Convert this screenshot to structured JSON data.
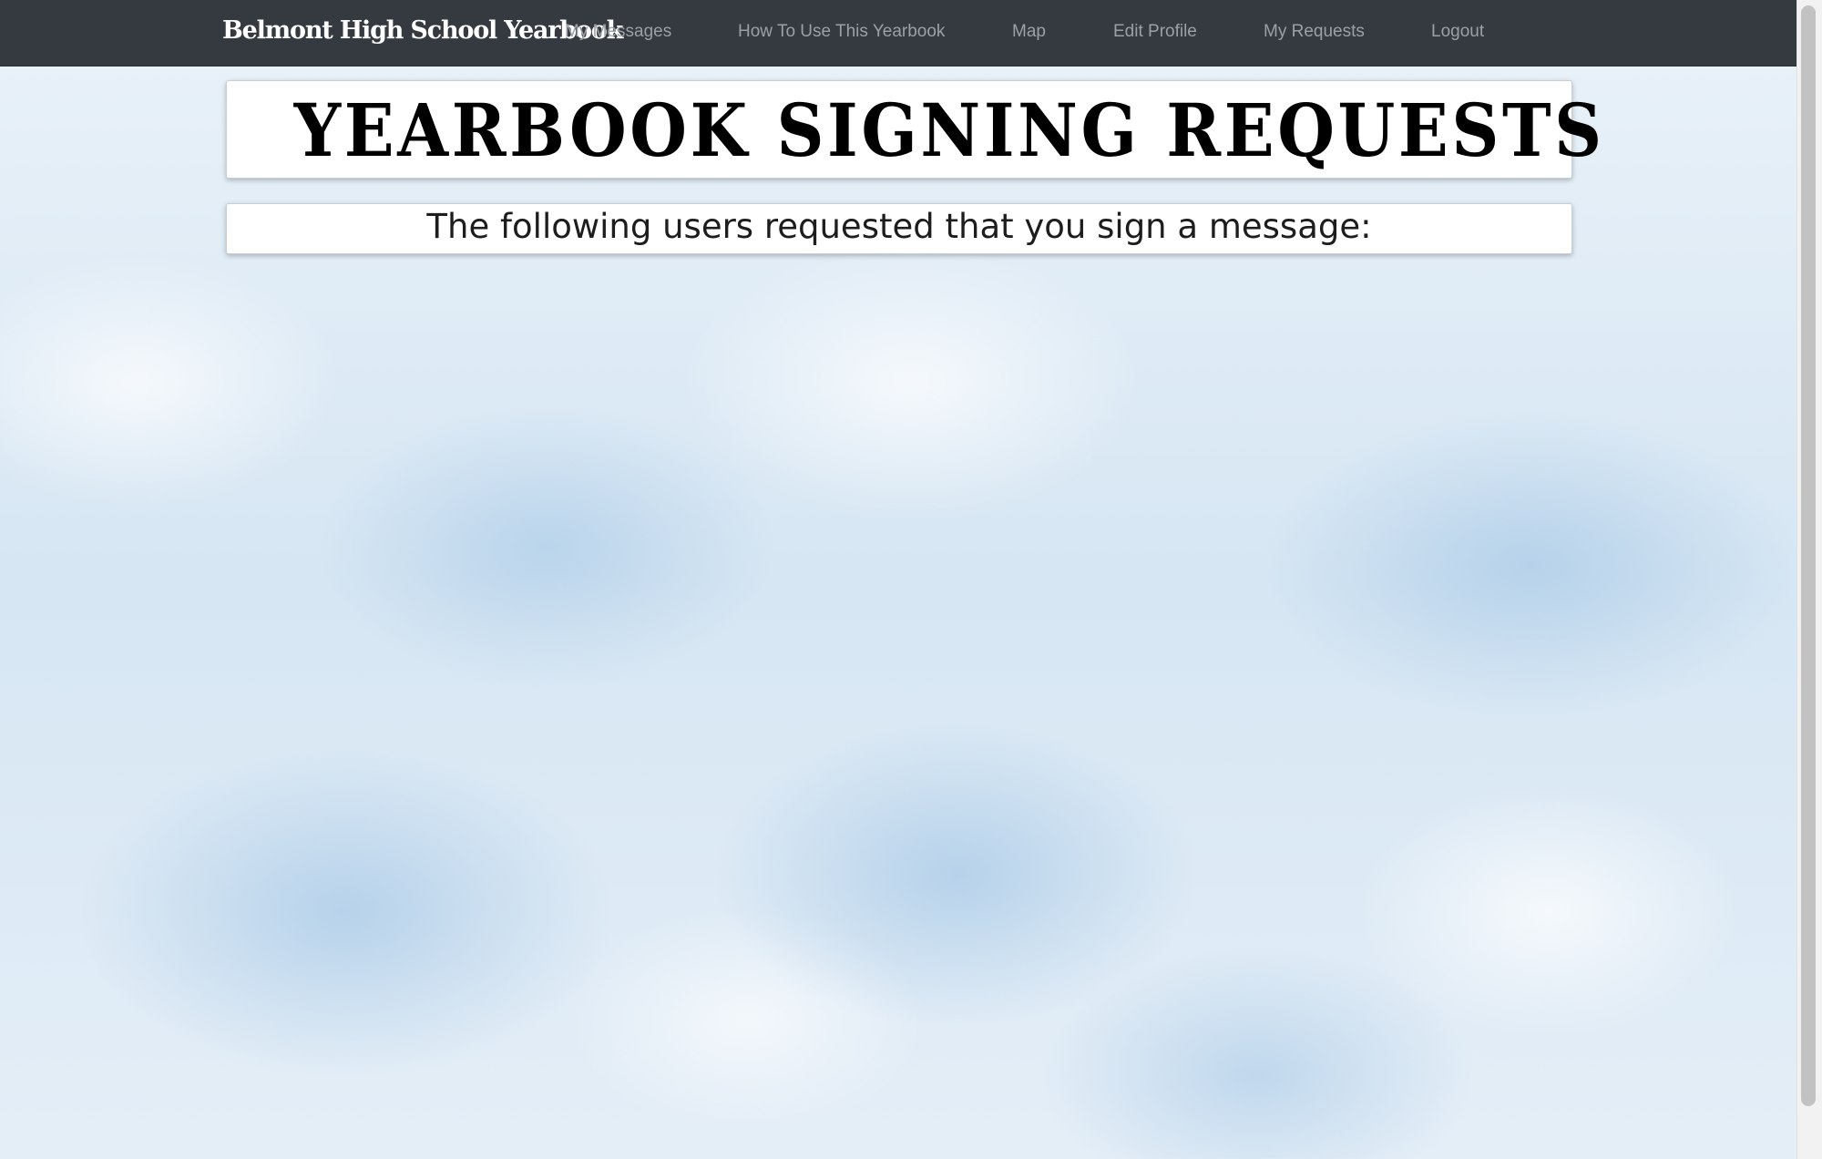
{
  "navbar": {
    "brand": "Belmont High School Yearbook",
    "links": [
      {
        "label": "My Messages"
      },
      {
        "label": "How To Use This Yearbook"
      },
      {
        "label": "Map"
      },
      {
        "label": "Edit Profile"
      },
      {
        "label": "My Requests"
      },
      {
        "label": "Logout"
      }
    ]
  },
  "main": {
    "title": "YEARBOOK SIGNING REQUESTS",
    "subtitle": "The following users requested that you sign a message:"
  },
  "colors": {
    "navbar_bg": "#343a40",
    "nav_link": "#9aa0a6",
    "brand_text": "#ffffff",
    "panel_bg": "#ffffff"
  }
}
